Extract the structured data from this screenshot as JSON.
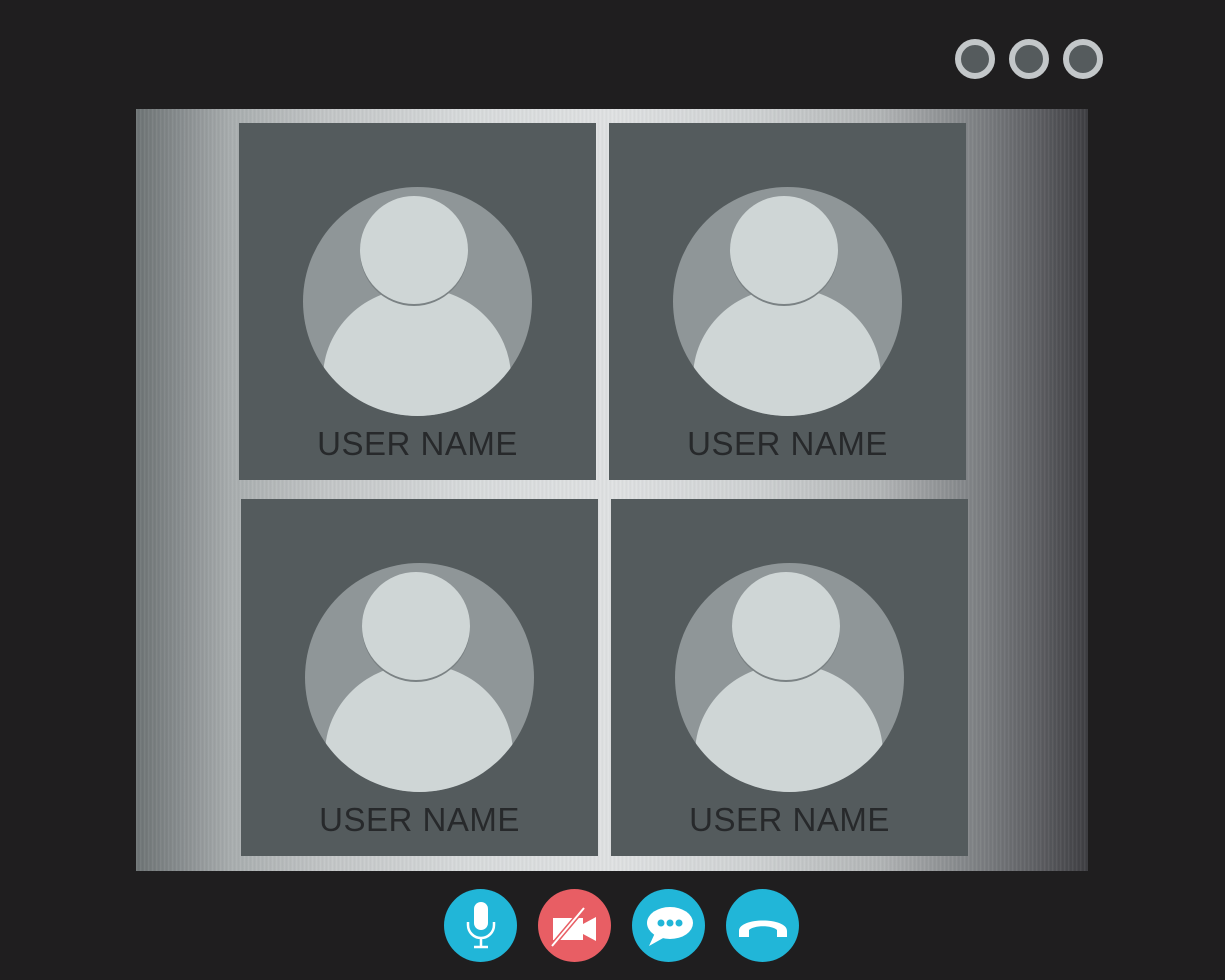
{
  "window_controls": [
    {
      "name": "dot-1"
    },
    {
      "name": "dot-2"
    },
    {
      "name": "dot-3"
    }
  ],
  "participants": [
    {
      "name": "USER NAME"
    },
    {
      "name": "USER NAME"
    },
    {
      "name": "USER NAME"
    },
    {
      "name": "USER NAME"
    }
  ],
  "controls": [
    {
      "icon": "microphone-icon",
      "color": "#21b6d8"
    },
    {
      "icon": "video-off-icon",
      "color": "#e85e64"
    },
    {
      "icon": "chat-bubble-icon",
      "color": "#21b6d8"
    },
    {
      "icon": "phone-hangup-icon",
      "color": "#21b6d8"
    }
  ],
  "colors": {
    "background": "#1f1e1f",
    "tile": "#545b5d",
    "avatar_circle": "#8f9698",
    "avatar_figure": "#cfd6d6",
    "name_text": "#27292b",
    "accent_blue": "#21b6d8",
    "accent_red": "#e85e64"
  }
}
